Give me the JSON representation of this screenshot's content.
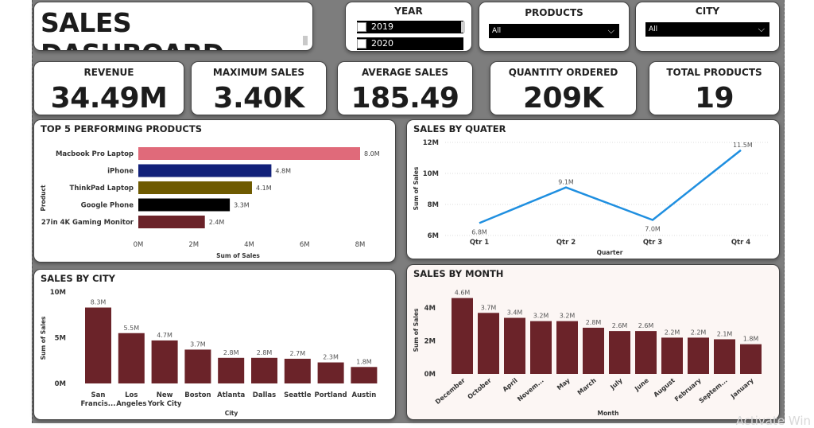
{
  "header": {
    "title": "SALES DASHBOARD"
  },
  "slicers": {
    "year": {
      "title": "YEAR",
      "items": [
        "2019",
        "2020"
      ]
    },
    "products": {
      "title": "PRODUCTS",
      "value": "All"
    },
    "city": {
      "title": "CITY",
      "value": "All"
    }
  },
  "kpis": [
    {
      "label": "REVENUE",
      "value": "34.49M"
    },
    {
      "label": "MAXIMUM SALES",
      "value": "3.40K"
    },
    {
      "label": "AVERAGE SALES",
      "value": "185.49"
    },
    {
      "label": "QUANTITY ORDERED",
      "value": "209K"
    },
    {
      "label": "TOTAL PRODUCTS",
      "value": "19"
    }
  ],
  "charts": {
    "top5": {
      "title": "TOP 5 PERFORMING PRODUCTS"
    },
    "quarter": {
      "title": "SALES BY QUATER"
    },
    "city": {
      "title": "SALES BY CITY"
    },
    "month": {
      "title": "SALES BY MONTH"
    }
  },
  "watermark": "Activate Win",
  "colors": {
    "dark_red": "#6b2329",
    "line_blue": "#1f8fe0",
    "pink": "#e06a7a",
    "navy": "#12217a",
    "olive": "#6e5a00",
    "black": "#000000"
  },
  "chart_data": [
    {
      "type": "bar",
      "orientation": "horizontal",
      "title": "TOP 5 PERFORMING PRODUCTS",
      "xlabel": "Sum of Sales",
      "ylabel": "Product",
      "categories": [
        "Macbook Pro Laptop",
        "iPhone",
        "ThinkPad Laptop",
        "Google Phone",
        "27in 4K Gaming Monitor"
      ],
      "values": [
        8.0,
        4.8,
        4.1,
        3.3,
        2.4
      ],
      "data_labels": [
        "8.0M",
        "4.8M",
        "4.1M",
        "3.3M",
        "2.4M"
      ],
      "bar_colors": [
        "#e06a7a",
        "#12217a",
        "#6e5a00",
        "#000000",
        "#6b2329"
      ],
      "xticks": [
        "0M",
        "2M",
        "4M",
        "6M",
        "8M"
      ],
      "xlim": [
        0,
        8
      ]
    },
    {
      "type": "line",
      "title": "SALES BY QUATER",
      "xlabel": "Quarter",
      "ylabel": "Sum of Sales",
      "categories": [
        "Qtr 1",
        "Qtr 2",
        "Qtr 3",
        "Qtr 4"
      ],
      "values": [
        6.8,
        9.1,
        7.0,
        11.5
      ],
      "data_labels": [
        "6.8M",
        "9.1M",
        "7.0M",
        "11.5M"
      ],
      "yticks": [
        "6M",
        "8M",
        "10M",
        "12M"
      ],
      "ylim": [
        6,
        12
      ],
      "color": "#1f8fe0"
    },
    {
      "type": "bar",
      "title": "SALES BY CITY",
      "xlabel": "City",
      "ylabel": "Sum of Sales",
      "categories": [
        "San Francis...",
        "Los Angeles",
        "New York City",
        "Boston",
        "Atlanta",
        "Dallas",
        "Seattle",
        "Portland",
        "Austin"
      ],
      "values": [
        8.3,
        5.5,
        4.7,
        3.7,
        2.8,
        2.8,
        2.7,
        2.3,
        1.8
      ],
      "data_labels": [
        "8.3M",
        "5.5M",
        "4.7M",
        "3.7M",
        "2.8M",
        "2.8M",
        "2.7M",
        "2.3M",
        "1.8M"
      ],
      "yticks": [
        "0M",
        "5M",
        "10M"
      ],
      "ylim": [
        0,
        10
      ],
      "color": "#6b2329"
    },
    {
      "type": "bar",
      "title": "SALES BY MONTH",
      "xlabel": "Month",
      "ylabel": "Sum of Sales",
      "categories": [
        "December",
        "October",
        "April",
        "Novem...",
        "May",
        "March",
        "July",
        "June",
        "August",
        "February",
        "Septem...",
        "January"
      ],
      "values": [
        4.6,
        3.7,
        3.4,
        3.2,
        3.2,
        2.8,
        2.6,
        2.6,
        2.2,
        2.2,
        2.1,
        1.8
      ],
      "data_labels": [
        "4.6M",
        "3.7M",
        "3.4M",
        "3.2M",
        "3.2M",
        "2.8M",
        "2.6M",
        "2.6M",
        "2.2M",
        "2.2M",
        "2.1M",
        "1.8M"
      ],
      "yticks": [
        "0M",
        "2M",
        "4M"
      ],
      "ylim": [
        0,
        5.5
      ],
      "color": "#6b2329"
    }
  ]
}
